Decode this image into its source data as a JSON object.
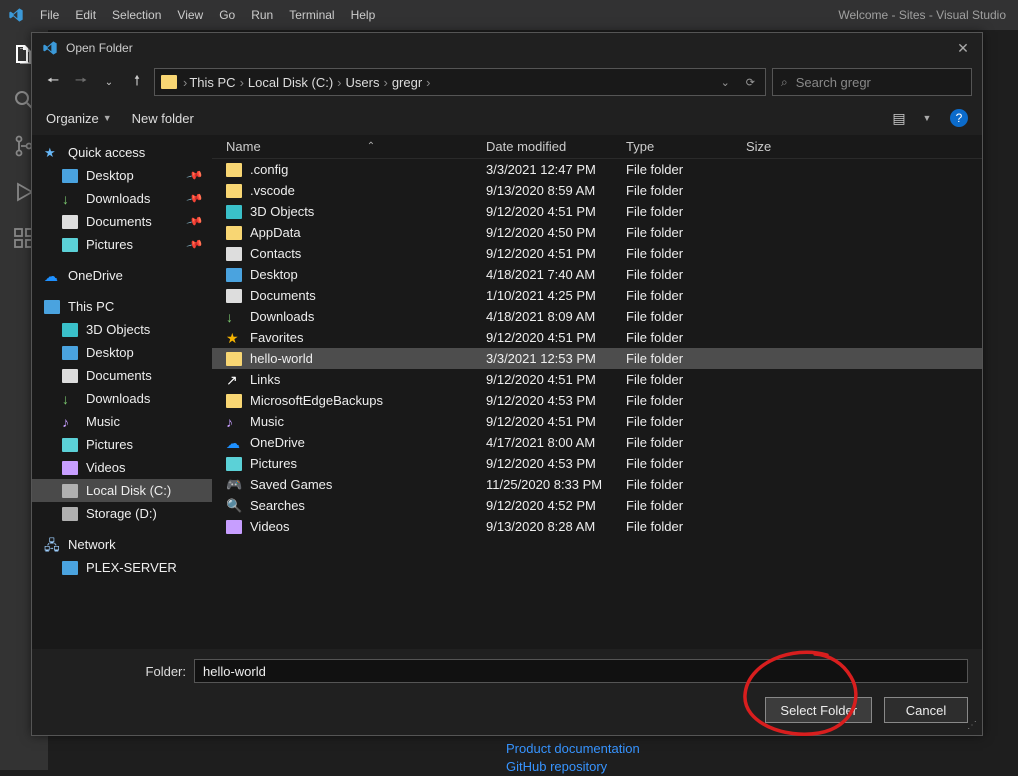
{
  "vscode": {
    "menus": [
      "File",
      "Edit",
      "Selection",
      "View",
      "Go",
      "Run",
      "Terminal",
      "Help"
    ],
    "window_title": "Welcome - Sites - Visual Studio"
  },
  "dialog": {
    "title": "Open Folder",
    "breadcrumb": [
      "This PC",
      "Local Disk (C:)",
      "Users",
      "gregr"
    ],
    "search_placeholder": "Search gregr",
    "organize": "Organize",
    "new_folder": "New folder",
    "help_glyph": "?",
    "columns": {
      "name": "Name",
      "date": "Date modified",
      "type": "Type",
      "size": "Size"
    },
    "folder_label": "Folder:",
    "folder_value": "hello-world",
    "select_btn": "Select Folder",
    "cancel_btn": "Cancel"
  },
  "nav": {
    "quick": "Quick access",
    "quick_items": [
      {
        "label": "Desktop",
        "icon": "desktop",
        "pin": true
      },
      {
        "label": "Downloads",
        "icon": "down",
        "pin": true
      },
      {
        "label": "Documents",
        "icon": "doc",
        "pin": true
      },
      {
        "label": "Pictures",
        "icon": "pic",
        "pin": true
      }
    ],
    "onedrive": "OneDrive",
    "thispc": "This PC",
    "pc_items": [
      {
        "label": "3D Objects",
        "icon": "cube"
      },
      {
        "label": "Desktop",
        "icon": "desktop"
      },
      {
        "label": "Documents",
        "icon": "doc"
      },
      {
        "label": "Downloads",
        "icon": "down"
      },
      {
        "label": "Music",
        "icon": "music"
      },
      {
        "label": "Pictures",
        "icon": "pic"
      },
      {
        "label": "Videos",
        "icon": "video"
      },
      {
        "label": "Local Disk (C:)",
        "icon": "drive",
        "sel": true
      },
      {
        "label": "Storage (D:)",
        "icon": "drive"
      }
    ],
    "network": "Network",
    "net_items": [
      {
        "label": "PLEX-SERVER",
        "icon": "pc"
      }
    ]
  },
  "files": [
    {
      "name": ".config",
      "date": "3/3/2021 12:47 PM",
      "type": "File folder",
      "icon": "folder"
    },
    {
      "name": ".vscode",
      "date": "9/13/2020 8:59 AM",
      "type": "File folder",
      "icon": "folder"
    },
    {
      "name": "3D Objects",
      "date": "9/12/2020 4:51 PM",
      "type": "File folder",
      "icon": "cube"
    },
    {
      "name": "AppData",
      "date": "9/12/2020 4:50 PM",
      "type": "File folder",
      "icon": "folder"
    },
    {
      "name": "Contacts",
      "date": "9/12/2020 4:51 PM",
      "type": "File folder",
      "icon": "doc"
    },
    {
      "name": "Desktop",
      "date": "4/18/2021 7:40 AM",
      "type": "File folder",
      "icon": "desktop"
    },
    {
      "name": "Documents",
      "date": "1/10/2021 4:25 PM",
      "type": "File folder",
      "icon": "doc"
    },
    {
      "name": "Downloads",
      "date": "4/18/2021 8:09 AM",
      "type": "File folder",
      "icon": "down"
    },
    {
      "name": "Favorites",
      "date": "9/12/2020 4:51 PM",
      "type": "File folder",
      "icon": "star2"
    },
    {
      "name": "hello-world",
      "date": "3/3/2021 12:53 PM",
      "type": "File folder",
      "icon": "folder",
      "sel": true
    },
    {
      "name": "Links",
      "date": "9/12/2020 4:51 PM",
      "type": "File folder",
      "icon": "link"
    },
    {
      "name": "MicrosoftEdgeBackups",
      "date": "9/12/2020 4:53 PM",
      "type": "File folder",
      "icon": "folder"
    },
    {
      "name": "Music",
      "date": "9/12/2020 4:51 PM",
      "type": "File folder",
      "icon": "music"
    },
    {
      "name": "OneDrive",
      "date": "4/17/2021 8:00 AM",
      "type": "File folder",
      "icon": "cloud"
    },
    {
      "name": "Pictures",
      "date": "9/12/2020 4:53 PM",
      "type": "File folder",
      "icon": "pic"
    },
    {
      "name": "Saved Games",
      "date": "11/25/2020 8:33 PM",
      "type": "File folder",
      "icon": "game"
    },
    {
      "name": "Searches",
      "date": "9/12/2020 4:52 PM",
      "type": "File folder",
      "icon": "search2"
    },
    {
      "name": "Videos",
      "date": "9/13/2020 8:28 AM",
      "type": "File folder",
      "icon": "video"
    }
  ],
  "bg_links": [
    "Product documentation",
    "GitHub repository"
  ]
}
